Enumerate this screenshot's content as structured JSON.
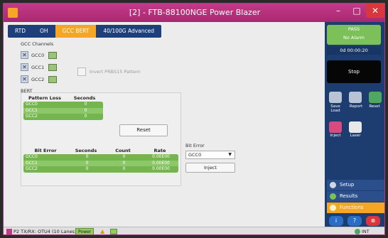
{
  "window": {
    "title": "[2] - FTB-88100NGE Power Blazer",
    "controls": {
      "minimize": "–",
      "maximize": "□",
      "close": "✕"
    }
  },
  "tabs": [
    {
      "label": "RTD",
      "active": false
    },
    {
      "label": "OH",
      "active": false
    },
    {
      "label": "GCC BERT",
      "active": true
    },
    {
      "label": "40/100G Advanced",
      "active": false
    }
  ],
  "gcc_channels": {
    "title": "GCC Channels",
    "items": [
      {
        "label": "GCC0"
      },
      {
        "label": "GCC1"
      },
      {
        "label": "GCC2"
      }
    ],
    "invert_label": "Invert PRBS15 Pattern"
  },
  "bert": {
    "title": "BERT",
    "pattern_loss": {
      "headers": [
        "Pattern Loss",
        "Seconds"
      ],
      "rows": [
        {
          "name": "GCC0",
          "seconds": "0"
        },
        {
          "name": "GCC1",
          "seconds": "0"
        },
        {
          "name": "GCC2",
          "seconds": "0"
        }
      ]
    },
    "bit_error": {
      "headers": [
        "Bit Error",
        "Seconds",
        "Count",
        "Rate"
      ],
      "rows": [
        {
          "name": "GCC0",
          "seconds": "0",
          "count": "0",
          "rate": "0.00E00"
        },
        {
          "name": "GCC1",
          "seconds": "0",
          "count": "0",
          "rate": "0.00E00"
        },
        {
          "name": "GCC2",
          "seconds": "0",
          "count": "0",
          "rate": "0.00E00"
        }
      ]
    },
    "reset_label": "Reset"
  },
  "bit_error_inject": {
    "label": "Bit Error",
    "selected": "GCC0",
    "inject_label": "Inject"
  },
  "status_panel": {
    "status": "PASS",
    "alarm": "No Alarm",
    "timer": "0d 00:00:20",
    "stop_label": "Stop"
  },
  "tools": {
    "save_load": "Save Load",
    "report": "Report",
    "reset": "Reset",
    "inject": "Inject",
    "laser": "Laser"
  },
  "nav": {
    "setup": "Setup",
    "results": "Results",
    "functions": "Functions"
  },
  "statusbar": {
    "text": "P2  TX/RX: OTU4 (10 Lanes)",
    "power": "Power",
    "clock": "INT"
  },
  "colors": {
    "title_bar": "#b8307c",
    "tab_active": "#f5a623",
    "pass_green": "#7cc05a",
    "table_green": "#7fbf5a",
    "panel_blue": "#1d3d70"
  }
}
